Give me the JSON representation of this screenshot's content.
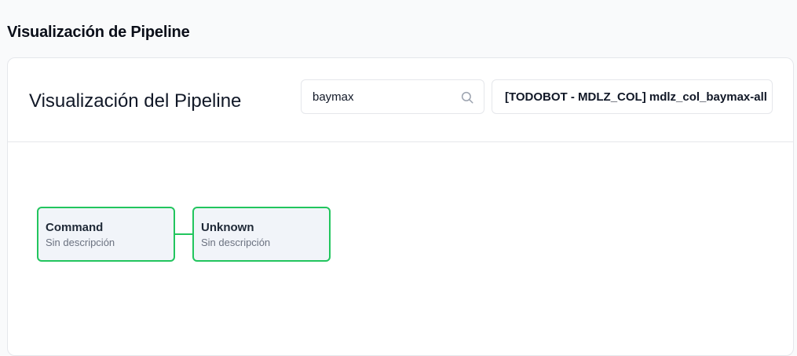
{
  "page": {
    "heading": "Visualización de Pipeline"
  },
  "card": {
    "title": "Visualización del Pipeline",
    "search": {
      "value": "baymax",
      "placeholder": ""
    },
    "pipeline_select": {
      "value": "[TODOBOT - MDLZ_COL] mdlz_col_baymax-all"
    }
  },
  "pipeline": {
    "nodes": [
      {
        "title": "Command",
        "description": "Sin descripción"
      },
      {
        "title": "Unknown",
        "description": "Sin descripción"
      }
    ],
    "edge_color": "#22c55e"
  },
  "icons": {
    "search": "search-icon"
  }
}
